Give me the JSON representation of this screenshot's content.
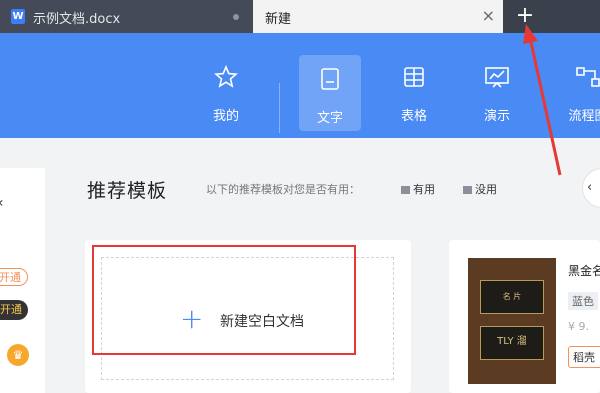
{
  "tabs": [
    {
      "title": "示例文档.docx",
      "icon": "W"
    },
    {
      "title": "新建",
      "close": "×"
    }
  ],
  "new_tab": "+",
  "ribbon": {
    "items": [
      {
        "label": "我的",
        "icon": "star-icon"
      },
      {
        "label": "文字",
        "icon": "document-icon"
      },
      {
        "label": "表格",
        "icon": "table-icon"
      },
      {
        "label": "演示",
        "icon": "presentation-icon"
      },
      {
        "label": "流程图",
        "icon": "flowchart-icon"
      }
    ],
    "active_index": 1
  },
  "left_panel": {
    "pill1": "开通",
    "pill2": "开通"
  },
  "section": {
    "title": "推荐模板",
    "hint": "以下的推荐模板对您是否有用：",
    "useful": "有用",
    "useless": "没用"
  },
  "blank_doc": {
    "plus": "+",
    "label": "新建空白文档"
  },
  "template": {
    "name": "黑金名片",
    "tag": "蓝色",
    "price": "¥ 9.",
    "brand": "稻壳",
    "card1_text": "名 片",
    "card2_text": "TLY 溜"
  },
  "colors": {
    "accent": "#4a8af4",
    "annotation": "#e53935",
    "tabbar": "#3b404d"
  }
}
